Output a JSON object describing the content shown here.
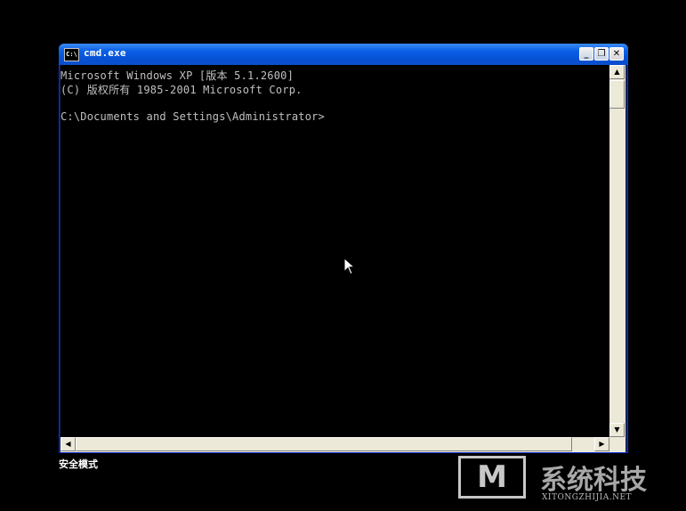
{
  "window": {
    "title": "cmd.exe",
    "icon_label": "C:\\",
    "buttons": {
      "minimize": "_",
      "maximize": "❐",
      "close": "✕"
    }
  },
  "console": {
    "lines": [
      "Microsoft Windows XP [版本 5.1.2600]",
      "(C) 版权所有 1985-2001 Microsoft Corp.",
      "",
      "C:\\Documents and Settings\\Administrator>"
    ]
  },
  "scrollbars": {
    "up": "▲",
    "down": "▼",
    "left": "◀",
    "right": "▶"
  },
  "desktop": {
    "safe_mode_label": "安全模式"
  },
  "watermark": {
    "logo_text": "M",
    "brand_text": "系统科技",
    "url_text": "XITONGZHIJIA.NET"
  },
  "colors": {
    "titlebar": "#0b5fe5",
    "console_bg": "#000000",
    "console_fg": "#c0c0c0"
  }
}
